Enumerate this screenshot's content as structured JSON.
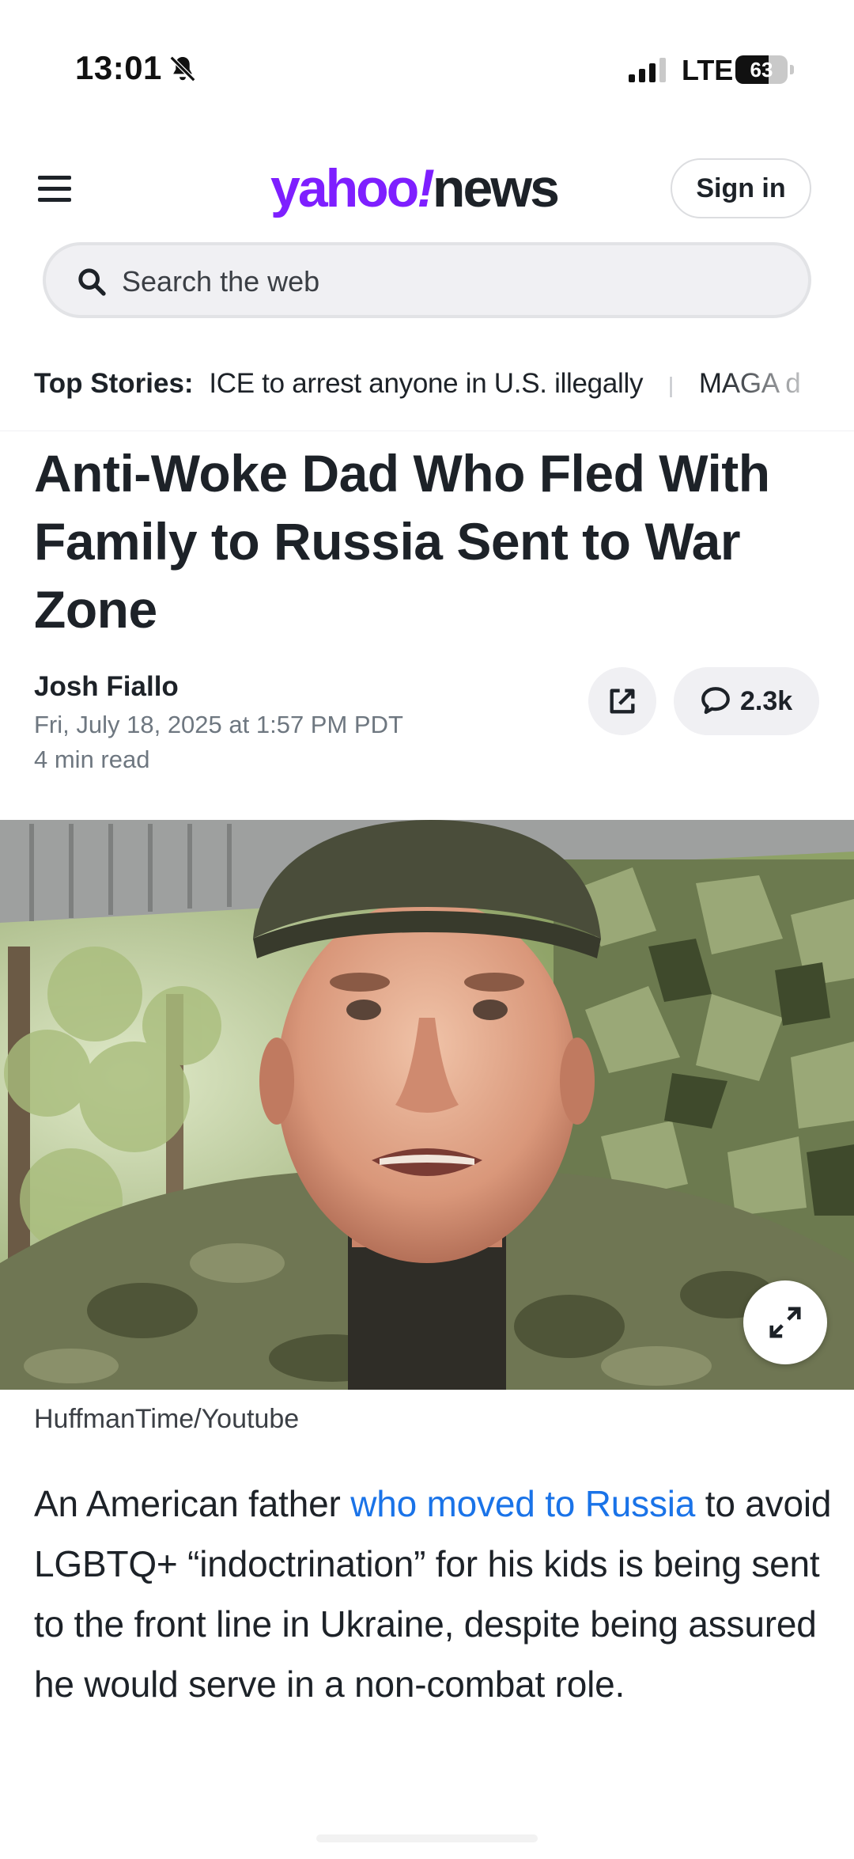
{
  "status_bar": {
    "time": "13:01",
    "network": "LTE",
    "battery": "63",
    "battery_level": 0.63,
    "icons": [
      "bell-slash-icon",
      "signal-icon",
      "battery-icon"
    ]
  },
  "header": {
    "logo": {
      "yahoo": "yahoo",
      "bang": "!",
      "news": "news"
    },
    "sign_in_label": "Sign in",
    "search_placeholder": "Search the web",
    "brand_color": "#7e1fff"
  },
  "top_stories": {
    "label": "Top Stories:",
    "items": [
      "ICE to arrest anyone in U.S. illegally",
      "MAGA d"
    ]
  },
  "article": {
    "headline": "Anti-Woke Dad Who Fled With Family to Russia Sent to War Zone",
    "author": "Josh Fiallo",
    "date": "Fri, July 18, 2025 at 1:57 PM PDT",
    "read_time": "4 min read",
    "comment_count": "2.3k",
    "image_credit": "HuffmanTime/Youtube",
    "body": {
      "before_link": "An American father ",
      "link_text": "who moved to Russia",
      "after_link": " to avoid LGBTQ+ “indoctrination” for his kids is being sent to the front line in Ukraine, despite being assured he would serve in a non-combat role."
    },
    "link_color": "#1a73e8"
  }
}
